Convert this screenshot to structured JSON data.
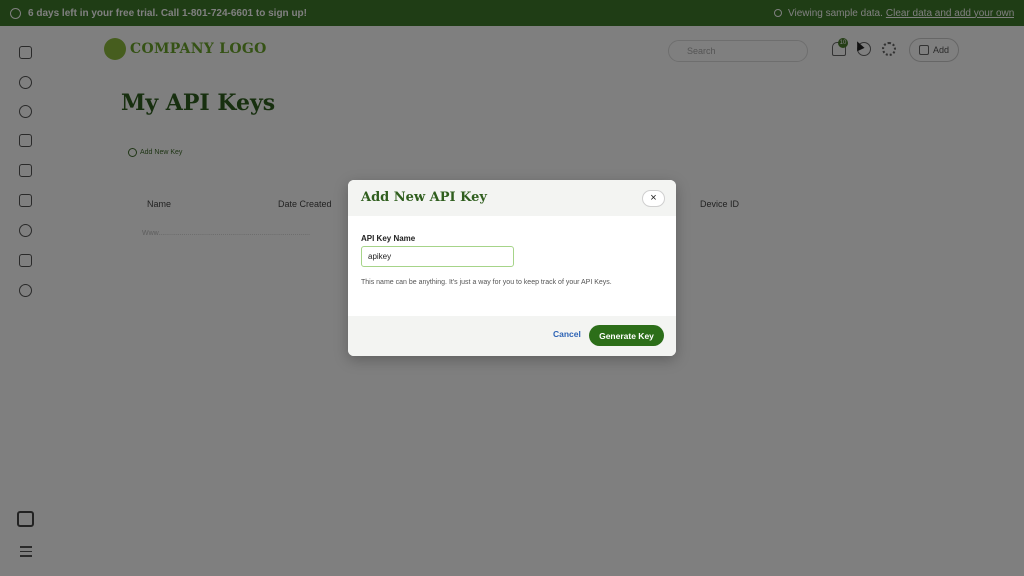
{
  "banner": {
    "trial_text": "6 days left in your free trial. Call 1-801-724-6601 to sign up!",
    "sample_text": "Viewing sample data.",
    "sample_link": "Clear data and add your own d..."
  },
  "header": {
    "logo_text": "COMPANY LOGO",
    "search_placeholder": "Search",
    "notifications_count": "10",
    "add_label": "Add"
  },
  "main": {
    "title": "My API Keys",
    "add_key_link": "Add New Key",
    "table_headers": [
      "Name",
      "Date Created",
      "Device ID"
    ],
    "row_placeholder": "Www.............................................................................."
  },
  "modal": {
    "title": "Add New API Key",
    "close_symbol": "×",
    "field_label": "API Key Name",
    "field_value": "apikey",
    "help_text": "This name can be anything. It's just a way for you to keep track of your API Keys.",
    "cancel_label": "Cancel",
    "generate_label": "Generate Key"
  },
  "colors": {
    "brand_green": "#2c6e19",
    "link_blue": "#2d63b5",
    "input_border": "#a6d489"
  },
  "icons": [
    "home-icon",
    "users-icon",
    "team-icon",
    "clipboard-icon",
    "chart-icon",
    "document-icon",
    "dollar-icon",
    "video-icon",
    "leaf-icon",
    "contact-icon",
    "menu-icon",
    "bell-icon",
    "help-icon",
    "gear-icon"
  ]
}
